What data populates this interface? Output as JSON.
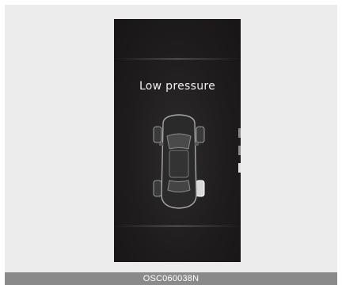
{
  "display": {
    "message": "Low pressure",
    "icon": "tire-pressure-car-icon"
  },
  "caption": {
    "code": "OSC060038N"
  }
}
